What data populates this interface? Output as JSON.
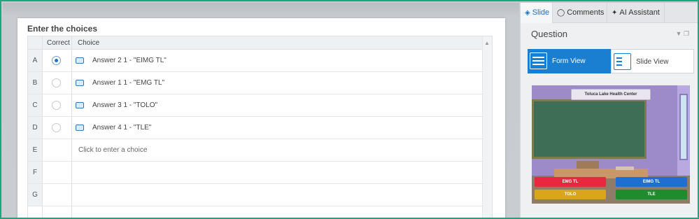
{
  "choices_panel": {
    "title": "Enter the choices",
    "headers": {
      "correct": "Correct",
      "choice": "Choice"
    },
    "rows": [
      {
        "letter": "A",
        "text": "Answer 2 1 - \"EIMG TL\"",
        "correct": true
      },
      {
        "letter": "B",
        "text": "Answer 1 1 - \"EMG TL\"",
        "correct": false
      },
      {
        "letter": "C",
        "text": "Answer 3 1 - \"TOLO\"",
        "correct": false
      },
      {
        "letter": "D",
        "text": "Answer 4 1 - \"TLE\"",
        "correct": false
      },
      {
        "letter": "E",
        "placeholder": "Click to enter a choice"
      },
      {
        "letter": "F"
      },
      {
        "letter": "G"
      }
    ]
  },
  "right_panel": {
    "tabs": [
      {
        "label": "Slide",
        "icon": "slide-icon",
        "active": true
      },
      {
        "label": "Comments",
        "icon": "comment-icon",
        "active": false
      },
      {
        "label": "AI Assistant",
        "icon": "sparkle-icon",
        "active": false
      }
    ],
    "section_title": "Question",
    "views": [
      {
        "label": "Form View",
        "icon": "form-view-icon",
        "active": true
      },
      {
        "label": "Slide View",
        "icon": "slide-view-icon",
        "active": false
      }
    ],
    "preview": {
      "title": "Toluca Lake Health Center",
      "answers": [
        {
          "label": "EMG TL",
          "color": "#e8283e"
        },
        {
          "label": "EIMG TL",
          "color": "#1f6fd1"
        },
        {
          "label": "TOLO",
          "color": "#d9a51b"
        },
        {
          "label": "TLE",
          "color": "#1e8b2c"
        }
      ]
    }
  },
  "colors": {
    "accent": "#1b7fd1",
    "frame_border": "#18a87e"
  }
}
